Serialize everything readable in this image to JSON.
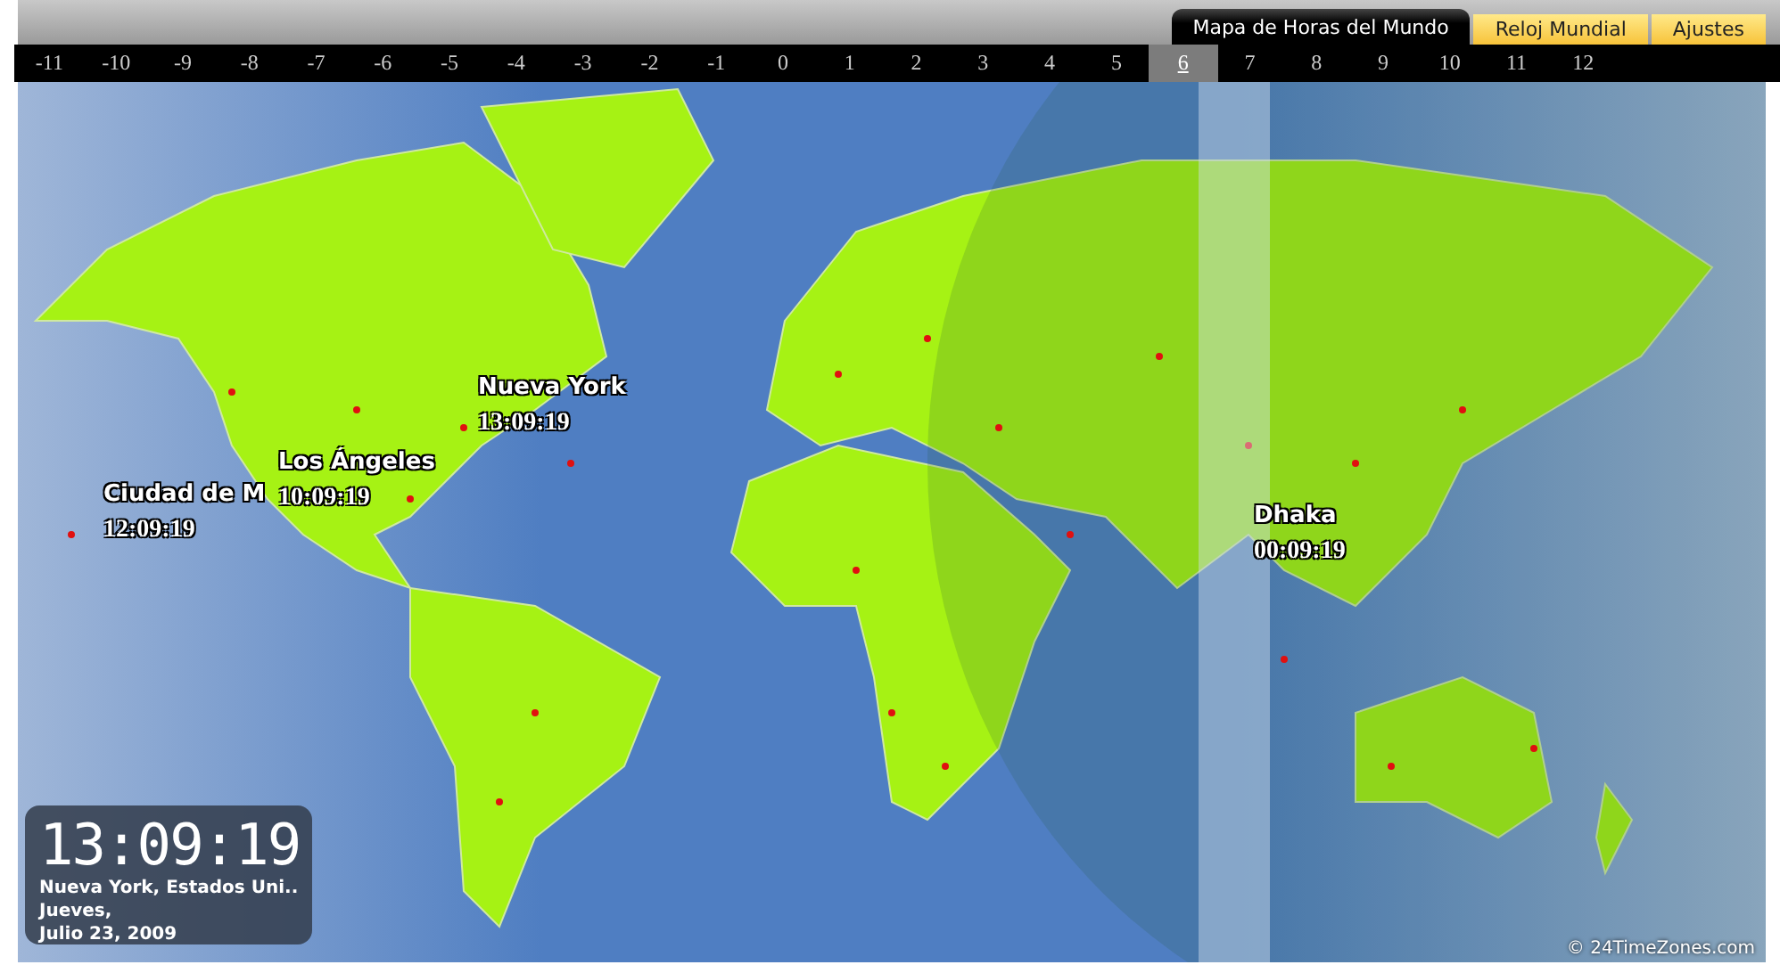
{
  "tabs": [
    {
      "label": "Mapa de Horas del Mundo",
      "selected": true
    },
    {
      "label": "Reloj Mundial",
      "selected": false
    },
    {
      "label": "Ajustes",
      "selected": false
    }
  ],
  "zones": [
    {
      "label": "-11",
      "selected": false
    },
    {
      "label": "-10",
      "selected": false
    },
    {
      "label": "-9",
      "selected": false
    },
    {
      "label": "-8",
      "selected": false
    },
    {
      "label": "-7",
      "selected": false
    },
    {
      "label": "-6",
      "selected": false
    },
    {
      "label": "-5",
      "selected": false
    },
    {
      "label": "-4",
      "selected": false
    },
    {
      "label": "-3",
      "selected": false
    },
    {
      "label": "-2",
      "selected": false
    },
    {
      "label": "-1",
      "selected": false
    },
    {
      "label": "0",
      "selected": false
    },
    {
      "label": "1",
      "selected": false
    },
    {
      "label": "2",
      "selected": false
    },
    {
      "label": "3",
      "selected": false
    },
    {
      "label": "4",
      "selected": false
    },
    {
      "label": "5",
      "selected": false
    },
    {
      "label": "6",
      "selected": true
    },
    {
      "label": "7",
      "selected": false
    },
    {
      "label": "8",
      "selected": false
    },
    {
      "label": "9",
      "selected": false
    },
    {
      "label": "10",
      "selected": false
    },
    {
      "label": "11",
      "selected": false
    },
    {
      "label": "12",
      "selected": false
    }
  ],
  "cities": [
    {
      "name": "Nueva York",
      "time": "13:09:19"
    },
    {
      "name": "Los Ángeles",
      "time": "10:09:19"
    },
    {
      "name": "Ciudad de M",
      "time": "12:09:19"
    },
    {
      "name": "Dhaka",
      "time": "00:09:19"
    }
  ],
  "clock": {
    "time": "13:09:19",
    "location": "Nueva York, Estados Uni..",
    "day": "Jueves,",
    "date": "Julio 23, 2009"
  },
  "copyright": "© 24TimeZones.com"
}
